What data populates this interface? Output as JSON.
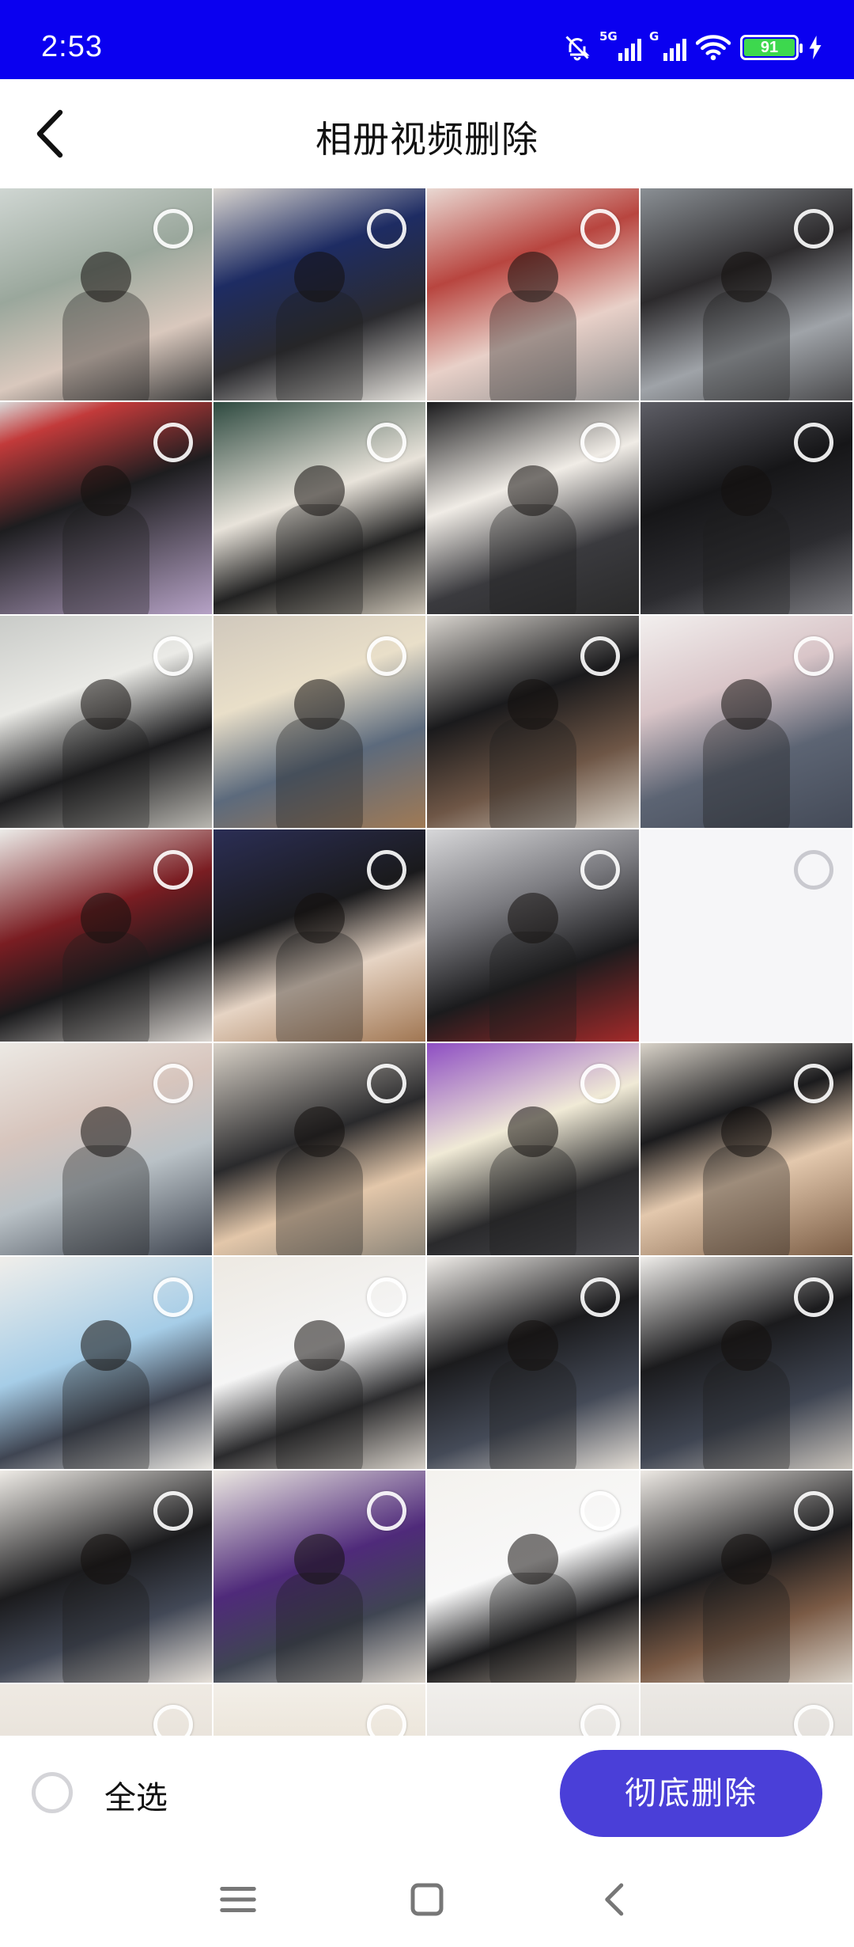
{
  "status_bar": {
    "time": "2:53",
    "network_1": "5G",
    "network_2": "G",
    "battery": "91",
    "color": "#0a00f0"
  },
  "header": {
    "title": "相册视频删除",
    "back_icon": "chevron-left-icon"
  },
  "grid": {
    "columns": 4,
    "items": [
      {
        "bg": "linear-gradient(160deg,#cfd6d2 0%,#9aa79c 40%,#d9c8bd 70%,#3a3a3a 100%)"
      },
      {
        "bg": "linear-gradient(160deg,#d8d4cf 0%,#1e2c63 35%,#2b2b2f 65%,#e9e6e0 100%)"
      },
      {
        "bg": "linear-gradient(160deg,#e9d8d2 0%,#b8453f 35%,#e8d0c8 65%,#8c8c8c 100%)"
      },
      {
        "bg": "linear-gradient(160deg,#8a8f94 0%,#2c2a2c 40%,#9fa3a8 70%,#4a4a4c 100%)"
      },
      {
        "bg": "linear-gradient(160deg,#d9d9d9 0%,#c23a3a 15%,#1d1d1f 45%,#b6a2c6 100%)"
      },
      {
        "bg": "linear-gradient(160deg,#2e4a40 0%,#e8e3da 45%,#222 70%,#c9c1b3 100%)"
      },
      {
        "bg": "linear-gradient(160deg,#1b1b1d 0%,#f0ece6 40%,#3a3a3e 70%,#2a2a2a 100%)"
      },
      {
        "bg": "linear-gradient(160deg,#5e5e66 0%,#161618 40%,#2c2c30 70%,#7b7b80 100%)"
      },
      {
        "bg": "linear-gradient(160deg,#c9cbc8 0%,#eaeae6 35%,#1c1c1e 65%,#b8b6b0 100%)"
      },
      {
        "bg": "linear-gradient(160deg,#d0c8bc 0%,#e9dfc9 35%,#5c6a7c 65%,#a07a55 100%)"
      },
      {
        "bg": "linear-gradient(160deg,#d8d4ce 0%,#1a1a1c 40%,#6e5646 70%,#d6cfc4 100%)"
      },
      {
        "bg": "linear-gradient(160deg,#f2efee 0%,#d9c5c8 35%,#5c6473 65%,#444a57 100%)"
      },
      {
        "bg": "linear-gradient(160deg,#ecebe8 0%,#7a1d22 40%,#1a1a1c 65%,#dcd7d2 100%)"
      },
      {
        "bg": "linear-gradient(160deg,#2b2e55 0%,#1a1a1c 40%,#e6d4c4 65%,#a07652 100%)"
      },
      {
        "bg": "linear-gradient(160deg,#d7d7d9 0%,#7b7b80 35%,#1b1b1d 65%,#a42a2a 100%)"
      },
      {
        "bg": "",
        "blank": true
      },
      {
        "bg": "linear-gradient(160deg,#ece9e4 0%,#d7c5bd 35%,#b9c1c6 60%,#3f4550 100%)"
      },
      {
        "bg": "linear-gradient(160deg,#d9d2c8 0%,#2a2a2c 45%,#e3c7aa 70%,#8b8478 100%)"
      },
      {
        "bg": "linear-gradient(160deg,#8e4ec3 0%,#f0ead6 40%,#2a2a2c 70%,#4d4d52 100%)"
      },
      {
        "bg": "linear-gradient(160deg,#d9d3c9 0%,#1b1b1d 35%,#e3c8ad 60%,#7b5d45 100%)"
      },
      {
        "bg": "linear-gradient(160deg,#f0eeea 0%,#a6cde7 45%,#3f4552 70%,#eae7e2 100%)"
      },
      {
        "bg": "linear-gradient(160deg,#ede9e2 0%,#f5f5f5 45%,#2b2b2d 70%,#d6d0c8 100%)"
      },
      {
        "bg": "linear-gradient(160deg,#f1eeea 0%,#1b1b1d 40%,#444a57 70%,#e4ded6 100%)"
      },
      {
        "bg": "linear-gradient(160deg,#efedea 0%,#1b1b1d 40%,#3f4552 70%,#c9c3bb 100%)"
      },
      {
        "bg": "linear-gradient(160deg,#eeebe6 0%,#1b1b1d 45%,#424856 70%,#e6e0d8 100%)"
      },
      {
        "bg": "linear-gradient(160deg,#ece8e2 0%,#4f2a7a 45%,#3f4552 70%,#d6cfc6 100%)"
      },
      {
        "bg": "linear-gradient(160deg,#f4f2ee 0%,#f8f8f8 45%,#1b1b1d 70%,#c7b8a8 100%)"
      },
      {
        "bg": "linear-gradient(160deg,#ede9e4 0%,#1b1b1d 45%,#7a5a45 70%,#d9d2c8 100%)"
      },
      {
        "bg": "linear-gradient(180deg,#efeae3 0%,#d8d0c5 100%)"
      },
      {
        "bg": "linear-gradient(180deg,#f3efe8 0%,#d7c9b3 100%)"
      },
      {
        "bg": "linear-gradient(180deg,#f1efec 0%,#d2cec8 100%)"
      },
      {
        "bg": "linear-gradient(180deg,#ece9e5 0%,#cfcac4 100%)"
      }
    ]
  },
  "bottom": {
    "select_all_label": "全选",
    "delete_label": "彻底删除",
    "accent": "#4a3fd8"
  },
  "nav": {
    "menu_icon": "menu-icon",
    "home_icon": "home-square-icon",
    "back_icon": "back-chevron-icon"
  }
}
